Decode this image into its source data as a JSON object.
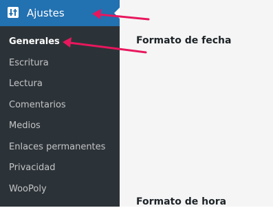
{
  "sidebar": {
    "header": {
      "label": "Ajustes",
      "icon": "sliders-icon"
    },
    "items": [
      {
        "label": "Generales",
        "current": true
      },
      {
        "label": "Escritura"
      },
      {
        "label": "Lectura"
      },
      {
        "label": "Comentarios"
      },
      {
        "label": "Medios"
      },
      {
        "label": "Enlaces permanentes"
      },
      {
        "label": "Privacidad"
      },
      {
        "label": "WooPoly"
      }
    ]
  },
  "main": {
    "date_format_label": "Formato de fecha",
    "time_format_label": "Formato de hora"
  },
  "colors": {
    "sidebar_bg": "#2c3338",
    "active_menu_bg": "#2271b1",
    "annotation_arrow": "#e8175d"
  }
}
